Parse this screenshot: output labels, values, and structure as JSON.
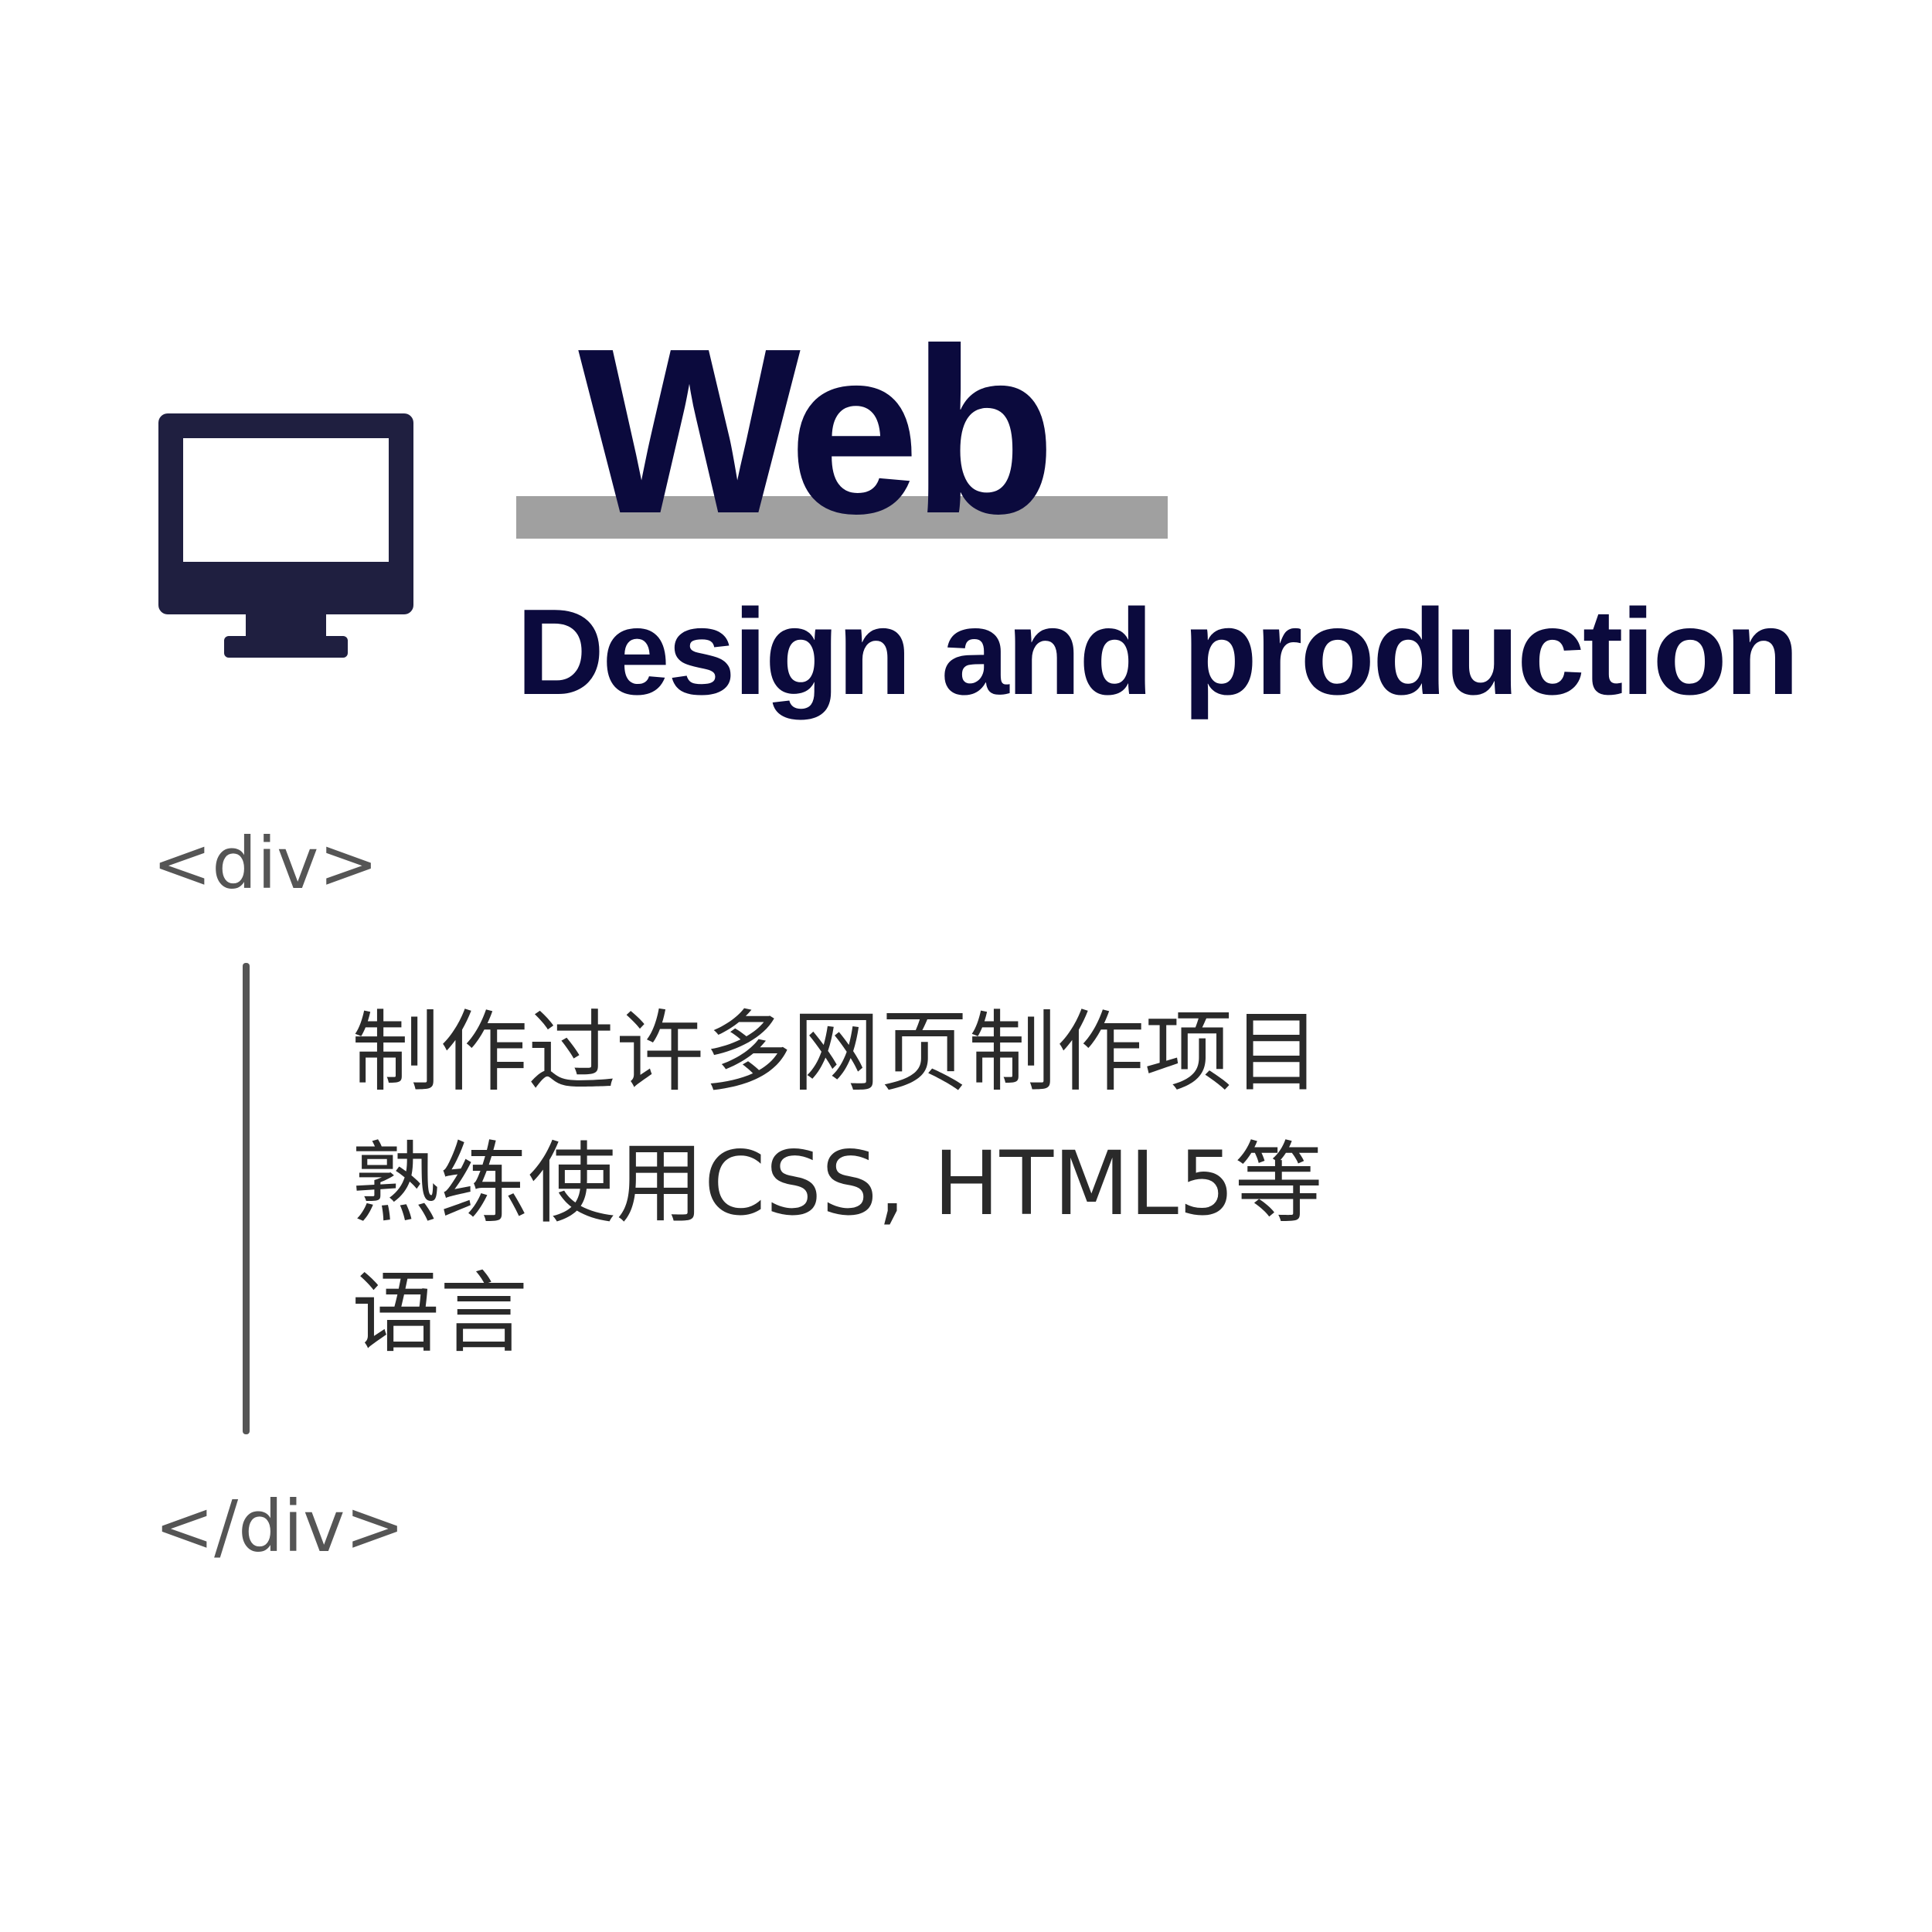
{
  "header": {
    "icon": "monitor-icon",
    "title": "Web",
    "subtitle": "Design and production"
  },
  "code_block": {
    "open_tag": "<div>",
    "close_tag": "</div>",
    "lines": [
      "制作过许多网页制作项目",
      "熟练使用CSS, HTML5等",
      "语言"
    ]
  },
  "colors": {
    "title": "#0b0a3d",
    "icon": "#1f1f40",
    "underline": "#a0a0a0",
    "tag": "#555555",
    "body_text": "#2a2a2a"
  }
}
